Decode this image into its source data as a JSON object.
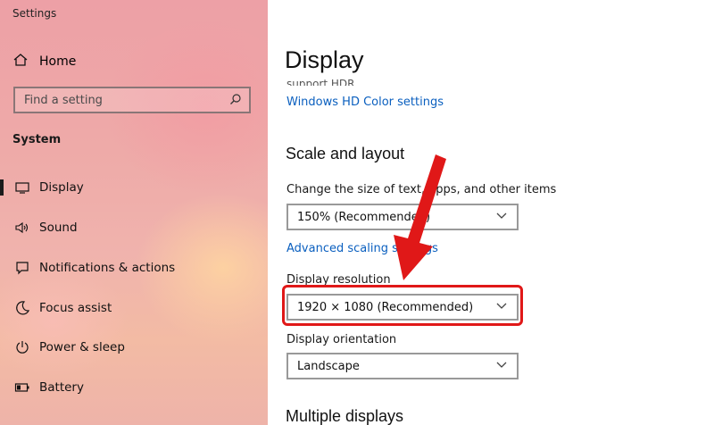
{
  "window": {
    "title": "Settings"
  },
  "sidebar": {
    "home_label": "Home",
    "search_placeholder": "Find a setting",
    "section_label": "System",
    "items": [
      {
        "label": "Display",
        "icon": "monitor-icon"
      },
      {
        "label": "Sound",
        "icon": "speaker-icon"
      },
      {
        "label": "Notifications & actions",
        "icon": "notification-icon"
      },
      {
        "label": "Focus assist",
        "icon": "moon-icon"
      },
      {
        "label": "Power & sleep",
        "icon": "power-icon"
      },
      {
        "label": "Battery",
        "icon": "battery-icon"
      }
    ],
    "active_item": "Display"
  },
  "main": {
    "title": "Display",
    "cut_text": "support HDR.",
    "hd_color_link": "Windows HD Color settings",
    "scale_heading": "Scale and layout",
    "scale_label": "Change the size of text, apps, and other items",
    "scale_value": "150% (Recommended)",
    "advanced_scaling_link": "Advanced scaling settings",
    "resolution_label": "Display resolution",
    "resolution_value": "1920 × 1080 (Recommended)",
    "orientation_label": "Display orientation",
    "orientation_value": "Landscape",
    "multiple_displays_heading": "Multiple displays"
  },
  "colors": {
    "accent_link": "#0a5fbf",
    "annotation_red": "#e01818"
  }
}
